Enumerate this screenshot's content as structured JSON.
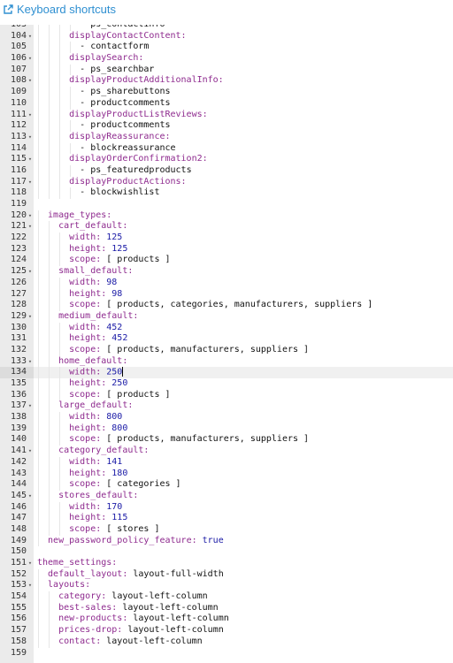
{
  "toolbar": {
    "shortcuts_label": "Keyboard shortcuts",
    "shortcuts_icon": "external-link-icon",
    "accent": "#2e8fd1"
  },
  "editor": {
    "colors": {
      "key": "#8e2a8e",
      "number": "#1a1aa6",
      "text": "#111111",
      "gutter": "#ebebeb"
    },
    "cursor_line": 134,
    "lines": [
      {
        "n": "103",
        "fold": false,
        "indent": 8,
        "parts": [
          {
            "t": "- ps_contactinfo",
            "c": "txt"
          }
        ]
      },
      {
        "n": "104",
        "fold": true,
        "indent": 6,
        "parts": [
          {
            "t": "displayContactContent:",
            "c": "key"
          }
        ]
      },
      {
        "n": "105",
        "fold": false,
        "indent": 8,
        "parts": [
          {
            "t": "- contactform",
            "c": "txt"
          }
        ]
      },
      {
        "n": "106",
        "fold": true,
        "indent": 6,
        "parts": [
          {
            "t": "displaySearch:",
            "c": "key"
          }
        ]
      },
      {
        "n": "107",
        "fold": false,
        "indent": 8,
        "parts": [
          {
            "t": "- ps_searchbar",
            "c": "txt"
          }
        ]
      },
      {
        "n": "108",
        "fold": true,
        "indent": 6,
        "parts": [
          {
            "t": "displayProductAdditionalInfo:",
            "c": "key"
          }
        ]
      },
      {
        "n": "109",
        "fold": false,
        "indent": 8,
        "parts": [
          {
            "t": "- ps_sharebuttons",
            "c": "txt"
          }
        ]
      },
      {
        "n": "110",
        "fold": false,
        "indent": 8,
        "parts": [
          {
            "t": "- productcomments",
            "c": "txt"
          }
        ]
      },
      {
        "n": "111",
        "fold": true,
        "indent": 6,
        "parts": [
          {
            "t": "displayProductListReviews:",
            "c": "key"
          }
        ]
      },
      {
        "n": "112",
        "fold": false,
        "indent": 8,
        "parts": [
          {
            "t": "- productcomments",
            "c": "txt"
          }
        ]
      },
      {
        "n": "113",
        "fold": true,
        "indent": 6,
        "parts": [
          {
            "t": "displayReassurance:",
            "c": "key"
          }
        ]
      },
      {
        "n": "114",
        "fold": false,
        "indent": 8,
        "parts": [
          {
            "t": "- blockreassurance",
            "c": "txt"
          }
        ]
      },
      {
        "n": "115",
        "fold": true,
        "indent": 6,
        "parts": [
          {
            "t": "displayOrderConfirmation2:",
            "c": "key"
          }
        ]
      },
      {
        "n": "116",
        "fold": false,
        "indent": 8,
        "parts": [
          {
            "t": "- ps_featuredproducts",
            "c": "txt"
          }
        ]
      },
      {
        "n": "117",
        "fold": true,
        "indent": 6,
        "parts": [
          {
            "t": "displayProductActions:",
            "c": "key"
          }
        ]
      },
      {
        "n": "118",
        "fold": false,
        "indent": 8,
        "parts": [
          {
            "t": "- blockwishlist",
            "c": "txt"
          }
        ]
      },
      {
        "n": "119",
        "fold": false,
        "indent": 0,
        "parts": []
      },
      {
        "n": "120",
        "fold": true,
        "indent": 2,
        "parts": [
          {
            "t": "image_types:",
            "c": "key"
          }
        ]
      },
      {
        "n": "121",
        "fold": true,
        "indent": 4,
        "parts": [
          {
            "t": "cart_default:",
            "c": "key"
          }
        ]
      },
      {
        "n": "122",
        "fold": false,
        "indent": 6,
        "parts": [
          {
            "t": "width: ",
            "c": "key"
          },
          {
            "t": "125",
            "c": "num"
          }
        ]
      },
      {
        "n": "123",
        "fold": false,
        "indent": 6,
        "parts": [
          {
            "t": "height: ",
            "c": "key"
          },
          {
            "t": "125",
            "c": "num"
          }
        ]
      },
      {
        "n": "124",
        "fold": false,
        "indent": 6,
        "parts": [
          {
            "t": "scope: ",
            "c": "key"
          },
          {
            "t": "[ products ]",
            "c": "txt"
          }
        ]
      },
      {
        "n": "125",
        "fold": true,
        "indent": 4,
        "parts": [
          {
            "t": "small_default:",
            "c": "key"
          }
        ]
      },
      {
        "n": "126",
        "fold": false,
        "indent": 6,
        "parts": [
          {
            "t": "width: ",
            "c": "key"
          },
          {
            "t": "98",
            "c": "num"
          }
        ]
      },
      {
        "n": "127",
        "fold": false,
        "indent": 6,
        "parts": [
          {
            "t": "height: ",
            "c": "key"
          },
          {
            "t": "98",
            "c": "num"
          }
        ]
      },
      {
        "n": "128",
        "fold": false,
        "indent": 6,
        "parts": [
          {
            "t": "scope: ",
            "c": "key"
          },
          {
            "t": "[ products, categories, manufacturers, suppliers ]",
            "c": "txt"
          }
        ]
      },
      {
        "n": "129",
        "fold": true,
        "indent": 4,
        "parts": [
          {
            "t": "medium_default:",
            "c": "key"
          }
        ]
      },
      {
        "n": "130",
        "fold": false,
        "indent": 6,
        "parts": [
          {
            "t": "width: ",
            "c": "key"
          },
          {
            "t": "452",
            "c": "num"
          }
        ]
      },
      {
        "n": "131",
        "fold": false,
        "indent": 6,
        "parts": [
          {
            "t": "height: ",
            "c": "key"
          },
          {
            "t": "452",
            "c": "num"
          }
        ]
      },
      {
        "n": "132",
        "fold": false,
        "indent": 6,
        "parts": [
          {
            "t": "scope: ",
            "c": "key"
          },
          {
            "t": "[ products, manufacturers, suppliers ]",
            "c": "txt"
          }
        ]
      },
      {
        "n": "133",
        "fold": true,
        "indent": 4,
        "parts": [
          {
            "t": "home_default:",
            "c": "key"
          }
        ]
      },
      {
        "n": "134",
        "fold": false,
        "indent": 6,
        "parts": [
          {
            "t": "width: ",
            "c": "key"
          },
          {
            "t": "250",
            "c": "num"
          }
        ],
        "cursor": true
      },
      {
        "n": "135",
        "fold": false,
        "indent": 6,
        "parts": [
          {
            "t": "height: ",
            "c": "key"
          },
          {
            "t": "250",
            "c": "num"
          }
        ]
      },
      {
        "n": "136",
        "fold": false,
        "indent": 6,
        "parts": [
          {
            "t": "scope: ",
            "c": "key"
          },
          {
            "t": "[ products ]",
            "c": "txt"
          }
        ]
      },
      {
        "n": "137",
        "fold": true,
        "indent": 4,
        "parts": [
          {
            "t": "large_default:",
            "c": "key"
          }
        ]
      },
      {
        "n": "138",
        "fold": false,
        "indent": 6,
        "parts": [
          {
            "t": "width: ",
            "c": "key"
          },
          {
            "t": "800",
            "c": "num"
          }
        ]
      },
      {
        "n": "139",
        "fold": false,
        "indent": 6,
        "parts": [
          {
            "t": "height: ",
            "c": "key"
          },
          {
            "t": "800",
            "c": "num"
          }
        ]
      },
      {
        "n": "140",
        "fold": false,
        "indent": 6,
        "parts": [
          {
            "t": "scope: ",
            "c": "key"
          },
          {
            "t": "[ products, manufacturers, suppliers ]",
            "c": "txt"
          }
        ]
      },
      {
        "n": "141",
        "fold": true,
        "indent": 4,
        "parts": [
          {
            "t": "category_default:",
            "c": "key"
          }
        ]
      },
      {
        "n": "142",
        "fold": false,
        "indent": 6,
        "parts": [
          {
            "t": "width: ",
            "c": "key"
          },
          {
            "t": "141",
            "c": "num"
          }
        ]
      },
      {
        "n": "143",
        "fold": false,
        "indent": 6,
        "parts": [
          {
            "t": "height: ",
            "c": "key"
          },
          {
            "t": "180",
            "c": "num"
          }
        ]
      },
      {
        "n": "144",
        "fold": false,
        "indent": 6,
        "parts": [
          {
            "t": "scope: ",
            "c": "key"
          },
          {
            "t": "[ categories ]",
            "c": "txt"
          }
        ]
      },
      {
        "n": "145",
        "fold": true,
        "indent": 4,
        "parts": [
          {
            "t": "stores_default:",
            "c": "key"
          }
        ]
      },
      {
        "n": "146",
        "fold": false,
        "indent": 6,
        "parts": [
          {
            "t": "width: ",
            "c": "key"
          },
          {
            "t": "170",
            "c": "num"
          }
        ]
      },
      {
        "n": "147",
        "fold": false,
        "indent": 6,
        "parts": [
          {
            "t": "height: ",
            "c": "key"
          },
          {
            "t": "115",
            "c": "num"
          }
        ]
      },
      {
        "n": "148",
        "fold": false,
        "indent": 6,
        "parts": [
          {
            "t": "scope: ",
            "c": "key"
          },
          {
            "t": "[ stores ]",
            "c": "txt"
          }
        ]
      },
      {
        "n": "149",
        "fold": false,
        "indent": 2,
        "parts": [
          {
            "t": "new_password_policy_feature: ",
            "c": "key"
          },
          {
            "t": "true",
            "c": "num"
          }
        ]
      },
      {
        "n": "150",
        "fold": false,
        "indent": 0,
        "parts": []
      },
      {
        "n": "151",
        "fold": true,
        "indent": 0,
        "parts": [
          {
            "t": "theme_settings:",
            "c": "key"
          }
        ]
      },
      {
        "n": "152",
        "fold": false,
        "indent": 2,
        "parts": [
          {
            "t": "default_layout: ",
            "c": "key"
          },
          {
            "t": "layout-full-width",
            "c": "txt"
          }
        ]
      },
      {
        "n": "153",
        "fold": true,
        "indent": 2,
        "parts": [
          {
            "t": "layouts:",
            "c": "key"
          }
        ]
      },
      {
        "n": "154",
        "fold": false,
        "indent": 4,
        "parts": [
          {
            "t": "category: ",
            "c": "key"
          },
          {
            "t": "layout-left-column",
            "c": "txt"
          }
        ]
      },
      {
        "n": "155",
        "fold": false,
        "indent": 4,
        "parts": [
          {
            "t": "best-sales: ",
            "c": "key"
          },
          {
            "t": "layout-left-column",
            "c": "txt"
          }
        ]
      },
      {
        "n": "156",
        "fold": false,
        "indent": 4,
        "parts": [
          {
            "t": "new-products: ",
            "c": "key"
          },
          {
            "t": "layout-left-column",
            "c": "txt"
          }
        ]
      },
      {
        "n": "157",
        "fold": false,
        "indent": 4,
        "parts": [
          {
            "t": "prices-drop: ",
            "c": "key"
          },
          {
            "t": "layout-left-column",
            "c": "txt"
          }
        ]
      },
      {
        "n": "158",
        "fold": false,
        "indent": 4,
        "parts": [
          {
            "t": "contact: ",
            "c": "key"
          },
          {
            "t": "layout-left-column",
            "c": "txt"
          }
        ]
      },
      {
        "n": "159",
        "fold": false,
        "indent": 0,
        "parts": []
      }
    ]
  }
}
